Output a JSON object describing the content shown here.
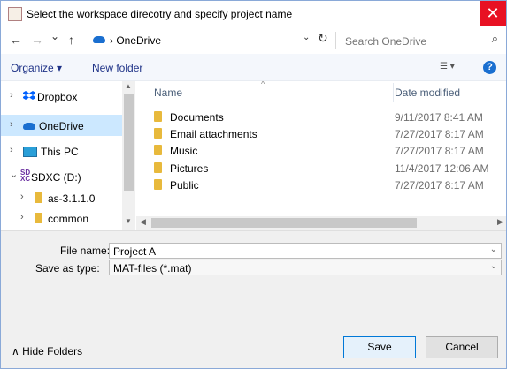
{
  "window": {
    "title": "Select the workspace direcotry and specify project name",
    "close_glyph": "✕"
  },
  "address": {
    "back": "←",
    "forward": "→",
    "recent": "⌄",
    "up": "↑",
    "breadcrumb": "› OneDrive",
    "search_placeholder": "Search OneDrive"
  },
  "toolbar": {
    "organize": "Organize ▾",
    "new_folder": "New folder",
    "help": "?"
  },
  "sidebar": {
    "items": [
      {
        "label": "Dropbox",
        "chevron": "›"
      },
      {
        "label": "OneDrive",
        "chevron": "›"
      },
      {
        "label": "This PC",
        "chevron": "›"
      },
      {
        "label": "SDXC (D:)",
        "chevron": "⌄"
      },
      {
        "label": "as-3.1.1.0",
        "chevron": "›"
      },
      {
        "label": "common",
        "chevron": "›"
      }
    ]
  },
  "files": {
    "columns": {
      "name": "Name",
      "date_modified": "Date modified"
    },
    "rows": [
      {
        "name": "Documents",
        "date": "9/11/2017 8:41 AM"
      },
      {
        "name": "Email attachments",
        "date": "7/27/2017 8:17 AM"
      },
      {
        "name": "Music",
        "date": "7/27/2017 8:17 AM"
      },
      {
        "name": "Pictures",
        "date": "11/4/2017 12:06 AM"
      },
      {
        "name": "Public",
        "date": "7/27/2017 8:17 AM"
      }
    ]
  },
  "form": {
    "filename_label": "File name:",
    "filename_value": "Project A",
    "savetype_label": "Save as type:",
    "savetype_value": "MAT-files (*.mat)"
  },
  "footer": {
    "hide_folders": "∧ Hide Folders",
    "save": "Save",
    "cancel": "Cancel"
  },
  "colors": {
    "accent": "#0078d7",
    "close": "#e81123",
    "selection": "#cce8ff",
    "folder": "#e8b93c"
  }
}
